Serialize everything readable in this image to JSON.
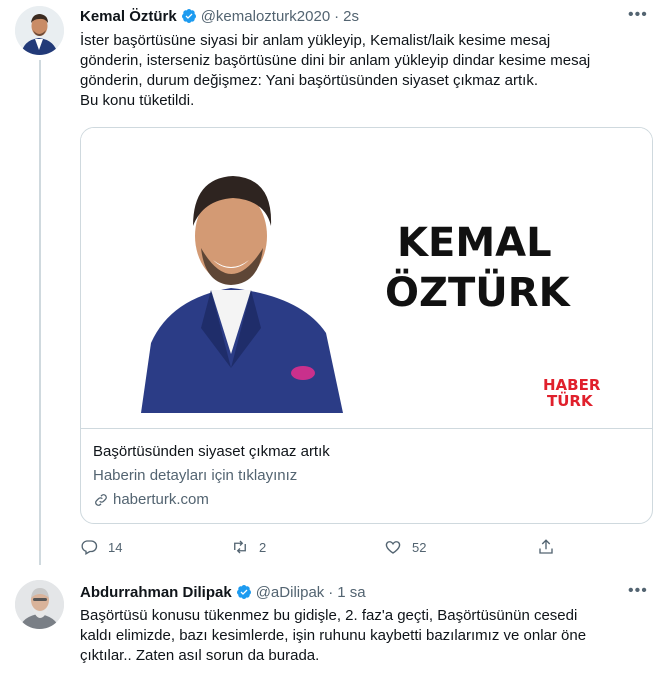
{
  "tweets": [
    {
      "name": "Kemal Öztürk",
      "handle": "@kemalozturk2020",
      "separator": "·",
      "time": "2s",
      "text": "İster başörtüsüne siyasi bir anlam yükleyip, Kemalist/laik kesime mesaj\ngönderin, isterseniz başörtüsüne dini bir anlam yükleyip dindar kesime mesaj\ngönderin, durum değişmez: Yani başörtüsünden siyaset çıkmaz artık.\nBu konu tüketildi.",
      "more": "•••"
    },
    {
      "name": "Abdurrahman Dilipak",
      "handle": "@aDilipak",
      "separator": "·",
      "time": "1 sa",
      "text": "Başörtüsü konusu tükenmez bu gidişle, 2. faz'a geçti, Başörtüsünün cesedi\nkaldı elimizde, bazı kesimlerde, işin ruhunu kaybetti bazılarımız ve onlar öne\nçıktılar.. Zaten asıl sorun da burada.",
      "more": "•••"
    }
  ],
  "card": {
    "banner_line1": "KEMAL",
    "banner_line2": "ÖZTÜRK",
    "logo_line1": "HABER",
    "logo_line2": "TÜRK",
    "title": "Başörtüsünden siyaset çıkmaz artık",
    "description": "Haberin detayları için tıklayınız",
    "domain": "haberturk.com"
  },
  "actions": {
    "reply_count": "14",
    "retweet_count": "2",
    "like_count": "52",
    "share_count": ""
  },
  "colors": {
    "verified": "#1d9bf0",
    "muted": "#536471",
    "border": "#cfd9de",
    "logo_red": "#e0202c"
  },
  "icons": [
    "verified-badge-icon",
    "more-icon",
    "reply-icon",
    "retweet-icon",
    "like-icon",
    "share-icon",
    "link-icon"
  ]
}
